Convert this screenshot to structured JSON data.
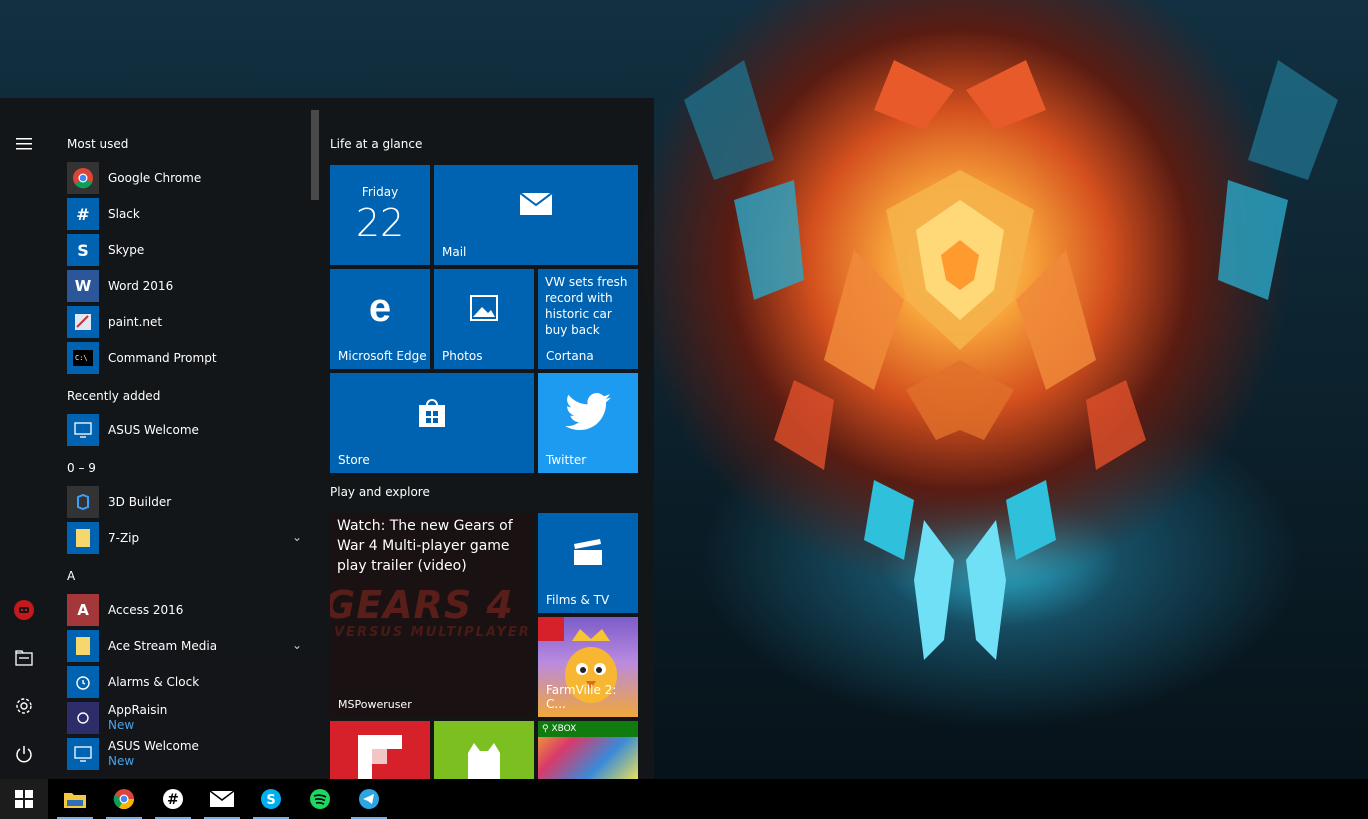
{
  "start_menu": {
    "rail": {
      "icons": [
        "hamburger-menu-icon",
        "user-avatar-icon",
        "file-explorer-icon",
        "settings-gear-icon",
        "power-icon"
      ]
    },
    "app_list": {
      "most_used_header": "Most used",
      "most_used": [
        {
          "label": "Google Chrome",
          "icon": "chrome-icon"
        },
        {
          "label": "Slack",
          "icon": "slack-icon"
        },
        {
          "label": "Skype",
          "icon": "skype-icon"
        },
        {
          "label": "Word 2016",
          "icon": "word-icon"
        },
        {
          "label": "paint.net",
          "icon": "paintnet-icon"
        },
        {
          "label": "Command Prompt",
          "icon": "cmd-icon"
        }
      ],
      "recently_added_header": "Recently added",
      "recently_added": [
        {
          "label": "ASUS Welcome",
          "icon": "asus-icon"
        }
      ],
      "section_09": "0 – 9",
      "section_09_items": [
        {
          "label": "3D Builder"
        },
        {
          "label": "7-Zip"
        }
      ],
      "section_a": "A",
      "section_a_items": [
        {
          "label": "Access 2016"
        },
        {
          "label": "Ace Stream Media"
        },
        {
          "label": "Alarms & Clock"
        },
        {
          "label": "AppRaisin",
          "badge": "New"
        },
        {
          "label": "ASUS Welcome",
          "badge": "New"
        }
      ]
    },
    "tiles": {
      "group1": "Life at a glance",
      "calendar": {
        "day": "Friday",
        "date": "22"
      },
      "mail": "Mail",
      "edge": "Microsoft Edge",
      "photos": "Photos",
      "cortana": {
        "news": "VW sets fresh record with historic car buy back",
        "label": "Cortana"
      },
      "store": "Store",
      "twitter": "Twitter",
      "group2": "Play and explore",
      "gears": {
        "headline": "Watch: The new Gears of War 4 Multi-player game play trailer (video)",
        "source": "MSPoweruser",
        "bg_text1": "GEARS 4",
        "bg_text2": "VERSUS MULTIPLAYER"
      },
      "films": "Films & TV",
      "farmville": "FarmVille 2: C...",
      "xbox": "XBOX"
    }
  },
  "taskbar": {
    "items": [
      "start-icon",
      "file-explorer-icon",
      "chrome-icon",
      "slack-icon",
      "mail-icon",
      "skype-icon",
      "spotify-icon",
      "telegram-icon"
    ]
  },
  "colors": {
    "accent": "#0063b1",
    "tile_light": "#1e90e8",
    "twitter": "#1da1f2",
    "start_bg": "#141618",
    "taskbar": "#000000"
  }
}
